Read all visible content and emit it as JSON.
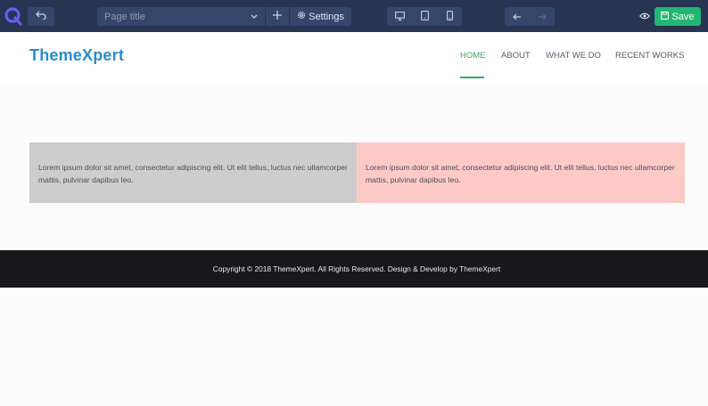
{
  "toolbar": {
    "page_title_placeholder": "Page title",
    "settings_label": "Settings",
    "save_label": "Save"
  },
  "site": {
    "brand": "ThemeXpert",
    "menu": [
      "HOME",
      "ABOUT",
      "WHAT WE DO",
      "RECENT WORKS"
    ],
    "active_menu": "HOME",
    "accent": "#3aa36b",
    "brand_color": "#2a8ccb"
  },
  "content": {
    "columns": [
      {
        "text": "Lorem ipsum dolor sit amet, consectetur adipiscing elit. Ut elit tellus, luctus nec ullamcorper mattis, pulvinar dapibus leo.",
        "bg": "#cdcdce"
      },
      {
        "text": "Lorem ipsum dolor sit amet, consectetur adipiscing elit. Ut elit tellus, luctus nec ullamcorper mattis, pulvinar dapibus leo.",
        "bg": "#fdcac8"
      }
    ]
  },
  "footer": {
    "copyright": "Copyright © 2018 ThemeXpert. All Rights Reserved. Design & Develop by ThemeXpert"
  },
  "icons": [
    "quix-logo-icon",
    "undo-icon",
    "chevron-down-icon",
    "plus-icon",
    "gear-icon",
    "desktop-icon",
    "tablet-icon",
    "mobile-icon",
    "arrow-left-icon",
    "arrow-right-icon",
    "eye-icon",
    "save-icon"
  ]
}
